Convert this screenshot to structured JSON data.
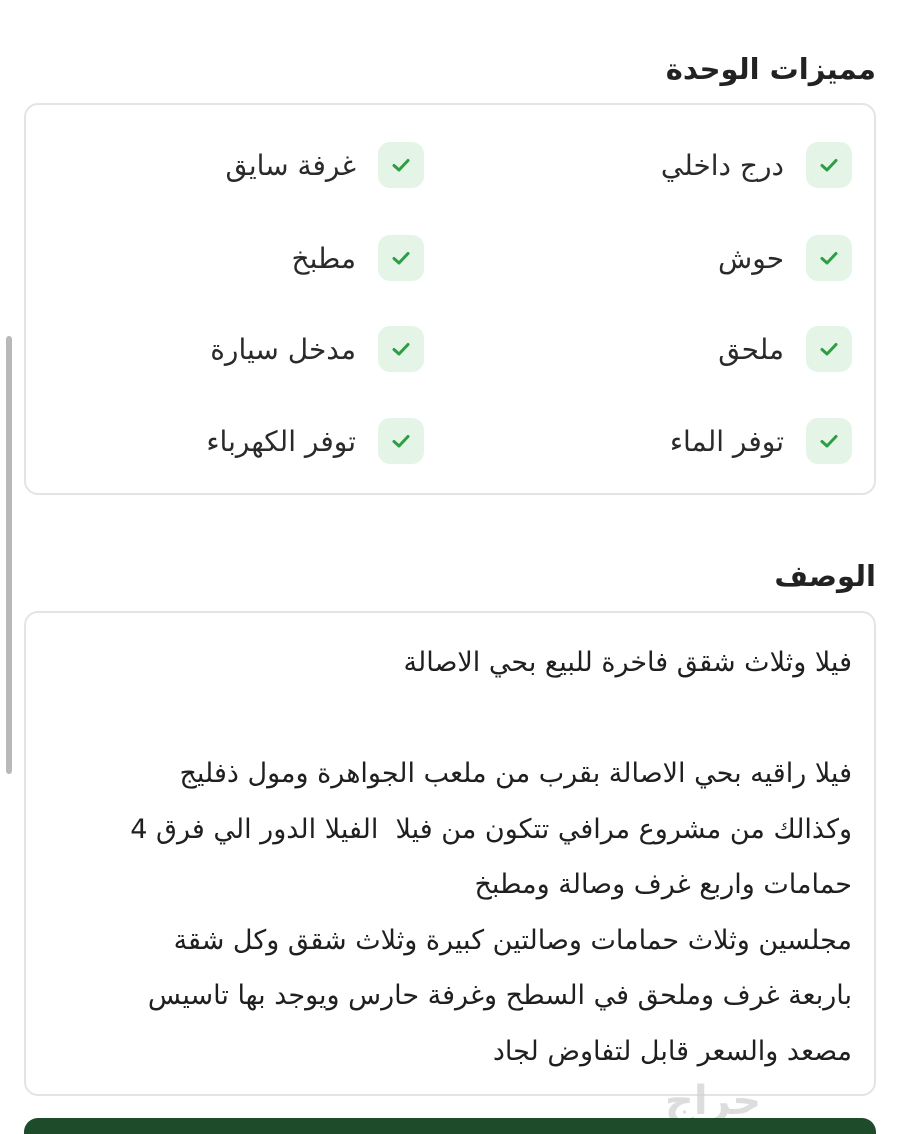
{
  "features": {
    "title": "مميزات الوحدة",
    "items": [
      {
        "label": "درج داخلي",
        "icon": "check-icon"
      },
      {
        "label": "غرفة سايق",
        "icon": "check-icon"
      },
      {
        "label": "حوش",
        "icon": "check-icon"
      },
      {
        "label": "مطبخ",
        "icon": "check-icon"
      },
      {
        "label": "ملحق",
        "icon": "check-icon"
      },
      {
        "label": "مدخل سيارة",
        "icon": "check-icon"
      },
      {
        "label": "توفر الماء",
        "icon": "check-icon"
      },
      {
        "label": "توفر الكهرباء",
        "icon": "check-icon"
      }
    ]
  },
  "description": {
    "title": "الوصف",
    "text": "فيلا وثلاث شقق فاخرة للبيع بحي الاصالة\n\nفيلا راقيه بحي الاصالة بقرب من ملعب الجواهرة ومول ذفليج\nوكذالك من مشروع مرافي تتكون من فيلا  الفيلا الدور الي فرق 4\nحمامات واربع غرف وصالة ومطبخ\nمجلسين وثلاث حمامات وصالتين كبيرة وثلاث شقق وكل شقة\nباربعة غرف وملحق في السطح وغرفة حارس ويوجد بها تاسيس\nمصعد والسعر قابل لتفاوض لجاد"
  },
  "watermark": "حراج",
  "colors": {
    "check_bg": "#e4f4e6",
    "check_mark": "#2e9e45",
    "bottom_bar": "#1e4b2a"
  }
}
